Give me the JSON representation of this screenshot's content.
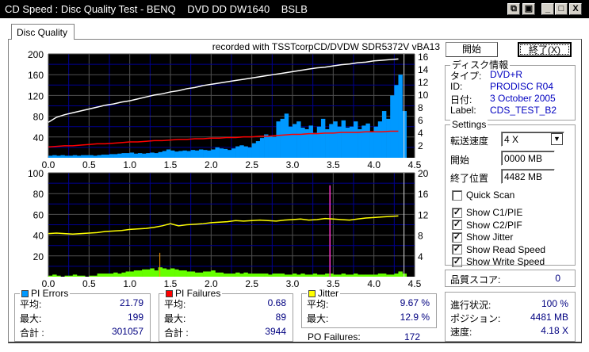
{
  "window": {
    "title": "CD Speed : Disc Quality Test - BENQ    DVD DD DW1640    BSLB"
  },
  "tabs": [
    {
      "label": "Disc Quality"
    }
  ],
  "chart_header": "recorded with TSSTcorpCD/DVDW SDR5372V vBA13",
  "buttons": {
    "start": "開始",
    "stop": "終了(X)"
  },
  "disc_info": {
    "title": "ディスク情報",
    "type_label": "タイプ:",
    "type": "DVD+R",
    "id_label": "ID:",
    "id": "PRODISC R04",
    "date_label": "日付:",
    "date": "3 October 2005",
    "label_label": "Label:",
    "label": "CDS_TEST_B2"
  },
  "settings": {
    "title": "Settings",
    "speed_label": "転送速度",
    "speed": "4 X",
    "start_label": "開始",
    "start": "0000 MB",
    "end_label": "終了位置",
    "end": "4482 MB",
    "checkboxes": [
      {
        "label": "Quick Scan",
        "checked": false
      },
      {
        "label": "Show C1/PIE",
        "checked": true
      },
      {
        "label": "Show C2/PIF",
        "checked": true
      },
      {
        "label": "Show Jitter",
        "checked": true
      },
      {
        "label": "Show Read Speed",
        "checked": true
      },
      {
        "label": "Show Write Speed",
        "checked": true
      }
    ]
  },
  "quality": {
    "label": "品質スコア:",
    "value": "0"
  },
  "pi_errors": {
    "title": "PI Errors",
    "color": "#0099ff",
    "avg_label": "平均:",
    "avg": "21.79",
    "max_label": "最大:",
    "max": "199",
    "total_label": "合計 :",
    "total": "301057"
  },
  "pi_failures": {
    "title": "PI Failures",
    "color": "#ff0000",
    "avg_label": "平均:",
    "avg": "0.68",
    "max_label": "最大:",
    "max": "89",
    "total_label": "合計 :",
    "total": "3944"
  },
  "jitter": {
    "title": "Jitter",
    "color": "#ffff00",
    "avg_label": "平均:",
    "avg": "9.67 %",
    "max_label": "最大:",
    "max": "12.9 %"
  },
  "po_failures": {
    "label": "PO Failures:",
    "value": "172"
  },
  "progress": {
    "progress_label": "進行状況:",
    "progress": "100 %",
    "position_label": "ポジション:",
    "position": "4481 MB",
    "speed_label": "速度:",
    "speed": "4.18 X"
  },
  "chart_data": [
    {
      "type": "bar",
      "x_ticks": [
        "0.0",
        "0.5",
        "1.0",
        "1.5",
        "2.0",
        "2.5",
        "3.0",
        "3.5",
        "4.0",
        "4.5"
      ],
      "xlim": [
        0,
        4.5
      ],
      "y_ticks": [
        "40",
        "80",
        "120",
        "160",
        "200"
      ],
      "ylim": [
        0,
        200
      ],
      "y2_ticks": [
        "2",
        "4",
        "6",
        "8",
        "10",
        "12",
        "14",
        "16"
      ],
      "y2lim": [
        0,
        16.4
      ],
      "grid": true,
      "pie_step": 0.05,
      "pie": [
        4,
        5,
        4,
        5,
        4,
        4,
        5,
        4,
        5,
        5,
        5,
        4,
        5,
        6,
        6,
        7,
        7,
        8,
        9,
        9,
        10,
        8,
        9,
        8,
        9,
        10,
        9,
        11,
        13,
        16,
        14,
        12,
        13,
        14,
        13,
        15,
        14,
        16,
        15,
        14,
        16,
        20,
        18,
        17,
        15,
        18,
        22,
        24,
        22,
        20,
        28,
        32,
        38,
        45,
        42,
        40,
        70,
        75,
        85,
        60,
        65,
        70,
        58,
        55,
        62,
        48,
        60,
        75,
        55,
        65,
        70,
        60,
        72,
        58,
        60,
        70,
        55,
        62,
        66,
        50,
        60,
        70,
        90,
        75,
        120,
        140,
        160,
        90
      ],
      "speed_step": 0.1,
      "read_speed": [
        5.6,
        6.4,
        6.8,
        7.1,
        7.4,
        7.7,
        8.0,
        8.3,
        8.5,
        8.8,
        9.0,
        9.3,
        9.6,
        9.9,
        10.1,
        10.4,
        10.6,
        10.9,
        11.1,
        11.4,
        11.6,
        11.8,
        12.0,
        12.2,
        12.4,
        12.6,
        12.8,
        13.0,
        13.2,
        13.4,
        13.6,
        13.8,
        14.0,
        14.2,
        14.3,
        14.5,
        14.7,
        14.8,
        15.0,
        15.1,
        15.3,
        15.4,
        15.5,
        15.6
      ],
      "write_speed": [
        1.7,
        1.8,
        1.9,
        1.9,
        2.0,
        2.1,
        2.2,
        2.2,
        2.3,
        2.4,
        2.5,
        2.5,
        2.6,
        2.7,
        2.7,
        2.8,
        2.9,
        2.9,
        3.0,
        3.0,
        3.1,
        3.1,
        3.2,
        3.2,
        3.3,
        3.3,
        3.4,
        3.4,
        3.5,
        3.6,
        3.7,
        3.7,
        3.8,
        3.8,
        3.9,
        3.9,
        4.0,
        4.0,
        4.0,
        4.1,
        4.1,
        4.1,
        4.2,
        4.2
      ],
      "colors": {
        "pie": "#0099ff",
        "read": "#ffffff",
        "write": "#ff0000"
      }
    },
    {
      "type": "bar",
      "x_ticks": [
        "0.0",
        "0.5",
        "1.0",
        "1.5",
        "2.0",
        "2.5",
        "3.0",
        "3.5",
        "4.0",
        "4.5"
      ],
      "xlim": [
        0,
        4.5
      ],
      "y_ticks": [
        "20",
        "40",
        "60",
        "80",
        "100"
      ],
      "ylim": [
        0,
        100
      ],
      "y2_ticks": [
        "4",
        "8",
        "12",
        "16",
        "20"
      ],
      "y2lim": [
        0,
        20
      ],
      "grid": true,
      "pif_step": 0.05,
      "pif": [
        1,
        2,
        1,
        0,
        1,
        1,
        2,
        1,
        1,
        0,
        1,
        1,
        3,
        3,
        3,
        3,
        4,
        3,
        4,
        5,
        5,
        6,
        6,
        7,
        7,
        8,
        6,
        9,
        8,
        7,
        8,
        7,
        6,
        6,
        5,
        5,
        4,
        4,
        5,
        5,
        6,
        4,
        4,
        3,
        3,
        3,
        4,
        3,
        4,
        3,
        3,
        3,
        3,
        3,
        2,
        3,
        3,
        3,
        2,
        2,
        3,
        2,
        3,
        2,
        2,
        3,
        2,
        2,
        3,
        3,
        2,
        2,
        3,
        2,
        2,
        3,
        2,
        2,
        2,
        2,
        2,
        3,
        3,
        2,
        2,
        3,
        5,
        3
      ],
      "pif_max": {
        "x": 1.37,
        "value": 23
      },
      "marker": {
        "x": 3.46,
        "value": 88
      },
      "jitter_step": 0.1,
      "jitter": [
        8.3,
        8.4,
        8.3,
        8.2,
        8.3,
        8.4,
        8.5,
        8.7,
        8.8,
        8.9,
        9.1,
        9.2,
        9.3,
        9.5,
        9.8,
        10.2,
        9.8,
        10.0,
        10.1,
        10.2,
        10.4,
        10.5,
        10.6,
        10.8,
        10.7,
        10.8,
        10.9,
        10.8,
        10.7,
        10.9,
        11.0,
        11.1,
        10.9,
        11.0,
        11.2,
        11.1,
        11.0,
        10.9,
        11.1,
        11.3,
        11.4,
        11.5,
        11.6,
        11.7
      ],
      "colors": {
        "pif": "#66ff00",
        "jitter": "#ffff00",
        "marker": "#ff33cc"
      }
    }
  ]
}
